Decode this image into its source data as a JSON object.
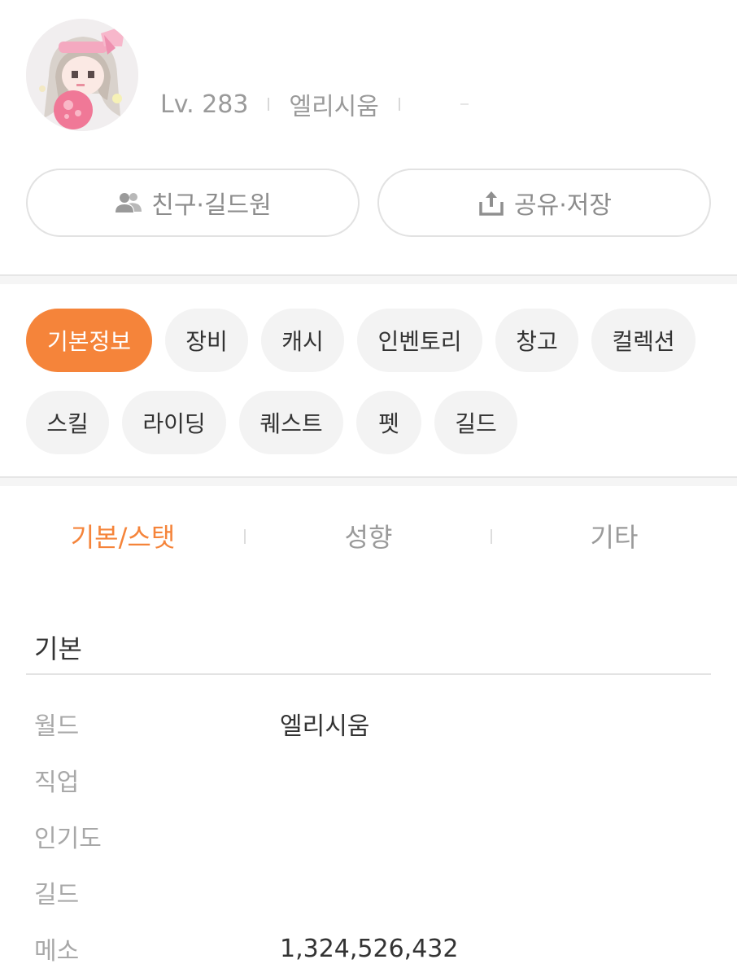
{
  "profile": {
    "level": "Lv. 283",
    "world": "엘리시움"
  },
  "actions": {
    "friends_label": "친구·길드원",
    "share_label": "공유·저장"
  },
  "tabs": [
    {
      "label": "기본정보",
      "active": true
    },
    {
      "label": "장비"
    },
    {
      "label": "캐시"
    },
    {
      "label": "인벤토리"
    },
    {
      "label": "창고"
    },
    {
      "label": "컬렉션"
    },
    {
      "label": "스킬"
    },
    {
      "label": "라이딩"
    },
    {
      "label": "퀘스트"
    },
    {
      "label": "펫"
    },
    {
      "label": "길드"
    }
  ],
  "subtabs": [
    {
      "label": "기본/스탯",
      "active": true
    },
    {
      "label": "성향"
    },
    {
      "label": "기타"
    }
  ],
  "basic": {
    "title": "기본",
    "rows": [
      {
        "key": "월드",
        "value": "엘리시움"
      },
      {
        "key": "직업",
        "value": ""
      },
      {
        "key": "인기도",
        "value": ""
      },
      {
        "key": "길드",
        "value": ""
      },
      {
        "key": "메소",
        "value": "1,324,526,432"
      }
    ]
  },
  "colors": {
    "accent": "#f5843a",
    "chip_bg": "#f3f3f3",
    "muted_text": "#9a9a9a"
  },
  "icons": {
    "friends": "people-icon",
    "share": "share-upload-icon"
  }
}
